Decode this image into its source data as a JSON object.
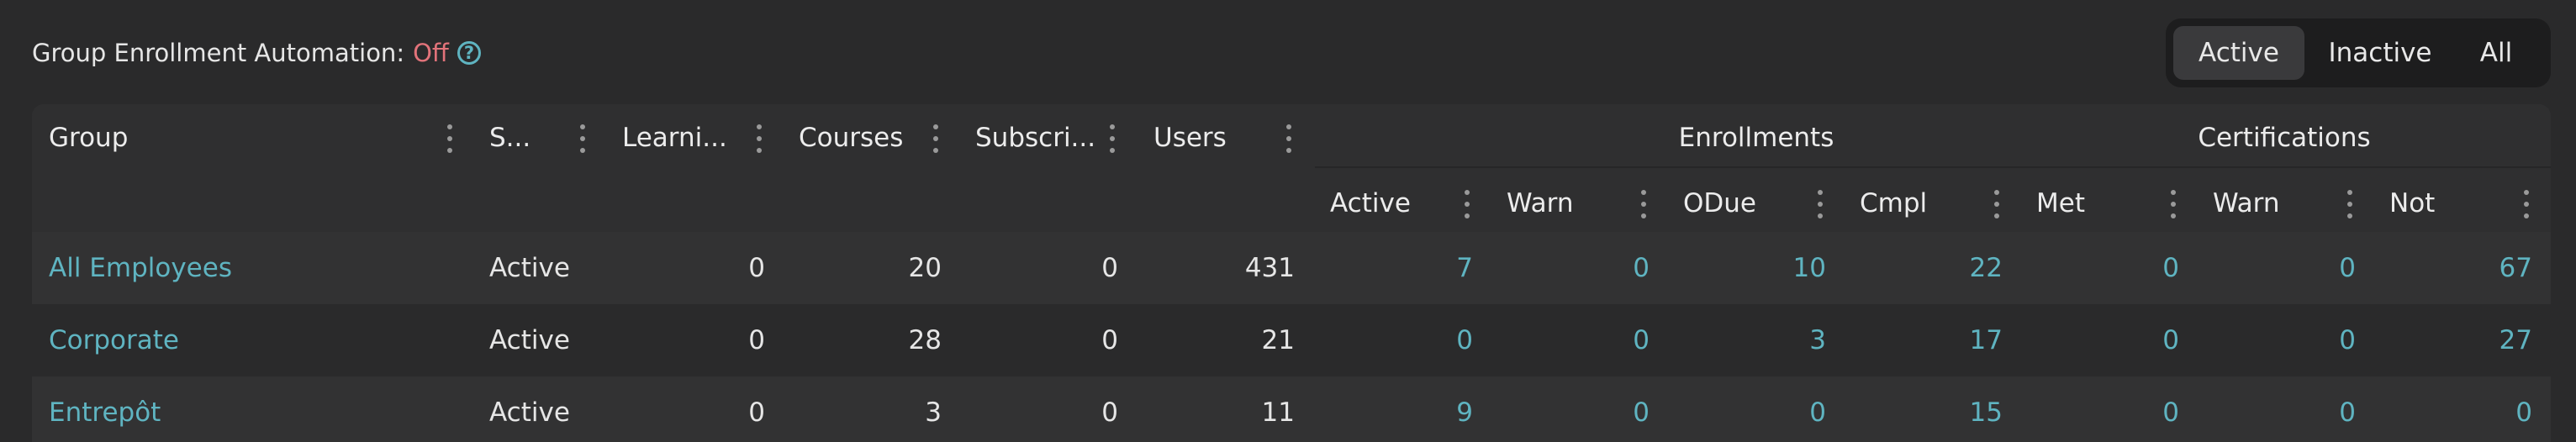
{
  "automation": {
    "label": "Group Enrollment Automation:",
    "status": "Off"
  },
  "filter": {
    "options": [
      "Active",
      "Inactive",
      "All"
    ],
    "selected": "Active"
  },
  "table": {
    "columns": [
      "Group",
      "S...",
      "Learni...",
      "Courses",
      "Subscri...",
      "Users"
    ],
    "enrollments": {
      "label": "Enrollments",
      "columns": [
        "Active",
        "Warn",
        "ODue",
        "Cmpl"
      ]
    },
    "certifications": {
      "label": "Certifications",
      "columns": [
        "Met",
        "Warn",
        "Not"
      ]
    },
    "rows": [
      {
        "group": "All Employees",
        "status": "Active",
        "learning": "0",
        "courses": "20",
        "subscriptions": "0",
        "users": "431",
        "enr_active": "7",
        "enr_warn": "0",
        "enr_odue": "10",
        "enr_cmpl": "22",
        "cert_met": "0",
        "cert_warn": "0",
        "cert_not": "67"
      },
      {
        "group": "Corporate",
        "status": "Active",
        "learning": "0",
        "courses": "28",
        "subscriptions": "0",
        "users": "21",
        "enr_active": "0",
        "enr_warn": "0",
        "enr_odue": "3",
        "enr_cmpl": "17",
        "cert_met": "0",
        "cert_warn": "0",
        "cert_not": "27"
      },
      {
        "group": "Entrepôt",
        "status": "Active",
        "learning": "0",
        "courses": "3",
        "subscriptions": "0",
        "users": "11",
        "enr_active": "9",
        "enr_warn": "0",
        "enr_odue": "0",
        "enr_cmpl": "15",
        "cert_met": "0",
        "cert_warn": "0",
        "cert_not": "0"
      }
    ]
  }
}
